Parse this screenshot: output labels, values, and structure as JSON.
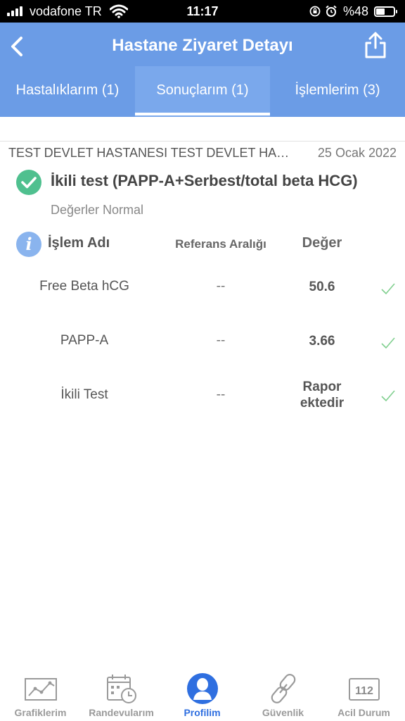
{
  "status_bar": {
    "carrier": "vodafone TR",
    "time": "11:17",
    "battery_text": "%48",
    "battery_level": 0.48
  },
  "header": {
    "title": "Hastane Ziyaret Detayı",
    "back_icon": "chevron-left-icon",
    "share_icon": "share-icon"
  },
  "tabs": [
    {
      "label": "Hastalıklarım (1)",
      "active": false
    },
    {
      "label": "Sonuçlarım (1)",
      "active": true
    },
    {
      "label": "İşlemlerim (3)",
      "active": false
    }
  ],
  "visit": {
    "hospital": "TEST DEVLET HASTANESI TEST DEVLET HASTANESI",
    "date": "25 Ocak 2022"
  },
  "result": {
    "title": "İkili test (PAPP-A+Serbest/total beta HCG)",
    "status": "Değerler Normal",
    "columns": {
      "name": "İşlem Adı",
      "reference": "Referans Aralığı",
      "value": "Değer"
    },
    "rows": [
      {
        "name": "Free Beta hCG",
        "reference": "--",
        "value": "50.6"
      },
      {
        "name": "PAPP-A",
        "reference": "--",
        "value": "3.66"
      },
      {
        "name": "İkili Test",
        "reference": "--",
        "value_line1": "Rapor",
        "value_line2": "ektedir"
      }
    ]
  },
  "colors": {
    "header_bg": "#6b9ce6",
    "success_green": "#4fc08f",
    "active_nav": "#2f6fe0"
  },
  "bottom_nav": [
    {
      "label": "Grafiklerim",
      "icon": "chart-icon"
    },
    {
      "label": "Randevularım",
      "icon": "calendar-clock-icon"
    },
    {
      "label": "Profilim",
      "icon": "profile-icon",
      "active": true
    },
    {
      "label": "Güvenlik",
      "icon": "link-icon"
    },
    {
      "label": "Acil Durum",
      "icon": "emergency-112-icon",
      "badge": "112"
    }
  ]
}
